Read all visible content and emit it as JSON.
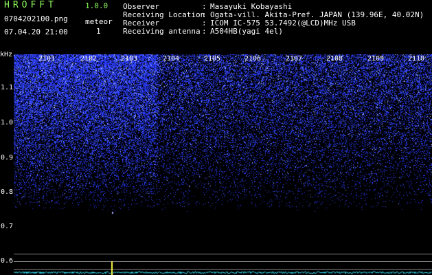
{
  "header": {
    "app_title": "HROFFT",
    "version": "1.0.0",
    "filename": "0704202100.png",
    "datetime": "07.04.20 21:00",
    "meteor_label": "meteor",
    "meteor_count": "1"
  },
  "info": [
    {
      "key": "Observer",
      "value": "Masayuki Kobayashi"
    },
    {
      "key": "Receiving Location",
      "value": "Ogata-vill. Akita-Pref. JAPAN (139.96E, 40.02N)"
    },
    {
      "key": "Receiver",
      "value": "ICOM IC-575 53.7492(@LCD)MHz USB"
    },
    {
      "key": "Receiving antenna",
      "value": "A504HB(yagi 4el)"
    }
  ],
  "separator": ":",
  "plot": {
    "y_unit": "kHz",
    "y_labels": [
      "1.1",
      "1.0",
      "0.9",
      "0.8",
      "0.7",
      "0.6"
    ],
    "time_labels": [
      "2101",
      "2102",
      "2103",
      "2104",
      "2105",
      "2106",
      "2107",
      "2108",
      "2109",
      "2110"
    ],
    "colors": {
      "background": "#000000",
      "noise": "#2a3cff",
      "trace": "#34e6ff",
      "spike": "#ffff40"
    }
  }
}
